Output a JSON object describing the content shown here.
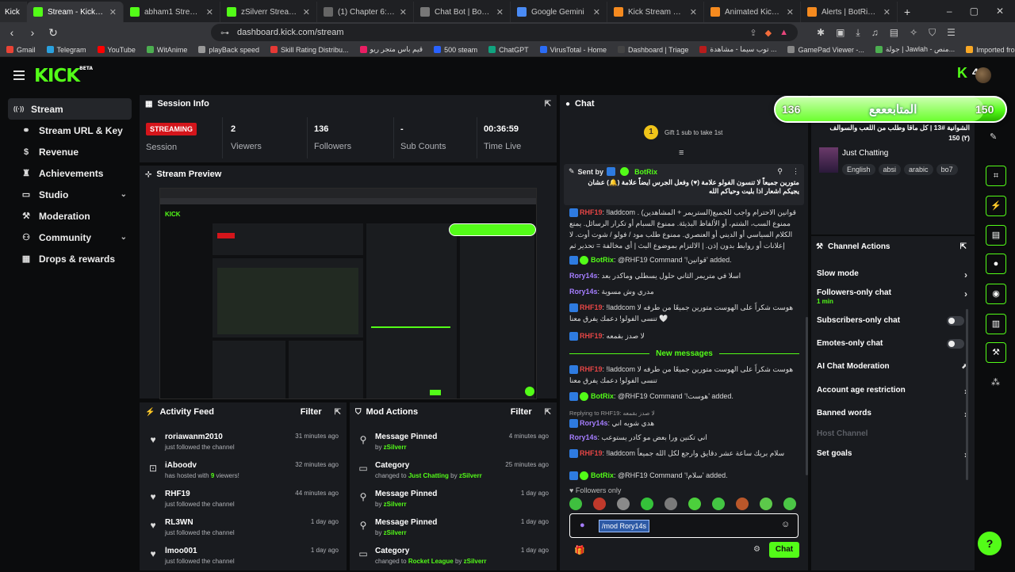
{
  "browser": {
    "tabs": [
      {
        "label": "Stream - Kick Dashbo",
        "color": "#53fc18",
        "active": true
      },
      {
        "label": "abham1 Stream - Watch",
        "color": "#53fc18"
      },
      {
        "label": "zSilverr Stream - Watch L",
        "color": "#53fc18"
      },
      {
        "label": "(1) Chapter 6: The End - Y",
        "color": "#666"
      },
      {
        "label": "Chat Bot | BotRix — Clou",
        "color": "#777"
      },
      {
        "label": "Google Gemini",
        "color": "#4a8bf5"
      },
      {
        "label": "Kick Stream Overlays & D",
        "color": "#f58a1f"
      },
      {
        "label": "Animated Kick Alerts for",
        "color": "#f58a1f"
      },
      {
        "label": "Alerts | BotRix — Cloud S",
        "color": "#f58a1f"
      }
    ],
    "first_tab": "Kick",
    "url": "dashboard.kick.com/stream",
    "bookmarks": [
      "Gmail",
      "Telegram",
      "YouTube",
      "WitAnime",
      "playBack speed",
      "Skill Rating Distribu...",
      "قيم باس متجر ريو",
      "500 steam",
      "ChatGPT",
      "VirusTotal - Home",
      "Dashboard | Triage",
      "توب سيما - مشاهدة ...",
      "GamePad Viewer -...",
      "جولة | Jawlah - منص...",
      "Imported from Go..."
    ]
  },
  "header": {
    "logo": "KICK",
    "beta": "BETA",
    "user_badge": "4"
  },
  "sidebar": {
    "items": [
      {
        "label": "Stream",
        "icon": "broadcast-icon",
        "active": true
      },
      {
        "label": "Stream URL & Key",
        "icon": "link-icon"
      },
      {
        "label": "Revenue",
        "icon": "dollar-icon"
      },
      {
        "label": "Achievements",
        "icon": "trophy-icon"
      },
      {
        "label": "Studio",
        "icon": "monitor-icon",
        "expand": true
      },
      {
        "label": "Moderation",
        "icon": "wrench-icon"
      },
      {
        "label": "Community",
        "icon": "community-icon",
        "expand": true
      },
      {
        "label": "Drops & rewards",
        "icon": "gift-icon"
      }
    ]
  },
  "session": {
    "title": "Session Info",
    "status": "STREAMING",
    "status_label": "Session",
    "stats": [
      {
        "value": "2",
        "label": "Viewers"
      },
      {
        "value": "136",
        "label": "Followers"
      },
      {
        "value": "-",
        "label": "Sub Counts"
      },
      {
        "value": "00:36:59",
        "label": "Time Live"
      }
    ]
  },
  "preview": {
    "title": "Stream Preview"
  },
  "activity": {
    "title": "Activity Feed",
    "filter": "Filter",
    "rows": [
      {
        "name": "roriawanm2010",
        "sub": "just followed the channel",
        "time": "31 minutes ago",
        "icon": "heart-icon"
      },
      {
        "name": "iAboodv",
        "sub_pre": "has hosted with ",
        "sub_num": "9",
        "sub_post": " viewers!",
        "time": "32 minutes ago",
        "icon": "host-icon"
      },
      {
        "name": "RHF19",
        "sub": "just followed the channel",
        "time": "44 minutes ago",
        "icon": "heart-icon"
      },
      {
        "name": "RL3WN",
        "sub": "just followed the channel",
        "time": "1 day ago",
        "icon": "heart-icon"
      },
      {
        "name": "lmoo001",
        "sub": "just followed the channel",
        "time": "1 day ago",
        "icon": "heart-icon"
      }
    ]
  },
  "mod_actions": {
    "title": "Mod Actions",
    "filter": "Filter",
    "rows": [
      {
        "name": "Message Pinned",
        "by": "by ",
        "user": "zSilverr",
        "time": "4 minutes ago",
        "icon": "pin-icon"
      },
      {
        "name": "Category",
        "sub_pre": "changed to ",
        "cat": "Just Chatting",
        "by": " by ",
        "user": "zSilverr",
        "time": "25 minutes ago",
        "icon": "category-icon"
      },
      {
        "name": "Message Pinned",
        "by": "by ",
        "user": "zSilverr",
        "time": "1 day ago",
        "icon": "pin-icon"
      },
      {
        "name": "Message Pinned",
        "by": "by ",
        "user": "zSilverr",
        "time": "1 day ago",
        "icon": "pin-icon"
      },
      {
        "name": "Category",
        "sub_pre": "changed to ",
        "cat": "Rocket League",
        "by": " by ",
        "user": "zSilverr",
        "time": "1 day ago",
        "icon": "category-icon"
      }
    ]
  },
  "chat": {
    "title": "Chat",
    "gift_coin": "1",
    "gift_text": "Gift 1 sub to take 1st",
    "pinned_sent_by": "Sent by",
    "pinned_user": "BotRix",
    "pinned_text": "متورين جميعاً لا تنسون الفولو علامة (♥) وفعل الجرس ايضاً علامة (🔔) عشان يجيكم اشعار اذا بليت وحياكم الله",
    "messages": [
      {
        "user": "RHF19",
        "type": "r",
        "text": "!laddcom قوانين الاحترام واجب للجميع(الستريمر + المشاهدين) . ممنوع السب، الشتم، أو الألفاظ البذيئة. ممنوع السبام أو تكرار الرسائل. يمنع الكلام السياسي أو الديني أو العنصري. ممنوع طلب مود / فولو / شوت أوت. لا إعلانات أو روابط بدون إذن. | الالتزام بموضوع البث | أي مخالفة = تحذير ثم حظر"
      },
      {
        "user": "BotRix",
        "type": "b",
        "text": "@RHF19 Command '!قوانين' added."
      },
      {
        "user": "Rory14s",
        "type": "p",
        "text": "اسلا في متريمر الثاني حلول يسطلي وماكدر بعد"
      },
      {
        "user": "Rory14s",
        "type": "p",
        "text": "مدري وش مسوية"
      },
      {
        "user": "RHF19",
        "type": "r",
        "text": "!laddcom هوست شكراً على الهوست متورين جميعًا من طرفه لا تنسى الفولو! دعمك يفرق معنا 🤍"
      },
      {
        "user": "RHF19",
        "type": "r",
        "text": "لا صدز بقمعه"
      }
    ],
    "new_messages": "New messages",
    "messages2": [
      {
        "user": "RHF19",
        "type": "r",
        "text": "!laddcom هوست شكراً على الهوست متورين جميعًا من طرفه لا تنسى الفولو! دعمك يفرق معنا"
      },
      {
        "user": "BotRix",
        "type": "b",
        "text": "@RHF19 Command '!هوست' added."
      },
      {
        "reply": "Replying to RHF19: لا صدز بقمعه",
        "user": "Rory14s",
        "type": "p",
        "text": "هدي شويه اني"
      },
      {
        "user": "Rory14s",
        "type": "p",
        "text": "اني تكنين ورا بعض مو كادر يستوعب"
      },
      {
        "user": "RHF19",
        "type": "r",
        "text": "!laddcom سلام بريك ساعة عشر دقايق وارجع لكل الله جميعاً"
      },
      {
        "user": "BotRix",
        "type": "b",
        "text": "@RHF19 Command '!سلام' added."
      }
    ],
    "followers_only": "Followers only",
    "input_value": "/mod Rory14s",
    "send_label": "Chat"
  },
  "channel_info": {
    "line1": "الشوانية #13 | كل ماقا وطلب من اللعب والسوالف",
    "line2": "(٢) 150",
    "category": "Just Chatting",
    "tags": [
      "English",
      "absi",
      "arabic",
      "bo7"
    ]
  },
  "channel_actions": {
    "title": "Channel Actions",
    "rows": [
      {
        "label": "Slow mode",
        "kind": "arrow"
      },
      {
        "label": "Followers-only chat",
        "sub": "1 min",
        "kind": "arrow"
      },
      {
        "label": "Subscribers-only chat",
        "kind": "toggle"
      },
      {
        "label": "Emotes-only chat",
        "kind": "toggle"
      },
      {
        "label": "AI Chat Moderation",
        "kind": "external"
      },
      {
        "label": "Account age restriction",
        "kind": "arrow"
      },
      {
        "label": "Banned words",
        "kind": "arrow"
      },
      {
        "label": "Host Channel",
        "kind": "disabled"
      },
      {
        "label": "Set goals",
        "kind": "arrow"
      }
    ]
  },
  "follower_goal": {
    "current": "136",
    "label": "المتابعععع",
    "target": "150",
    "progress": 0.9067
  },
  "colors": {
    "accent": "#53fc18",
    "live": "#d4151b",
    "panel": "#191b1f",
    "bg": "#0b0c0d"
  }
}
